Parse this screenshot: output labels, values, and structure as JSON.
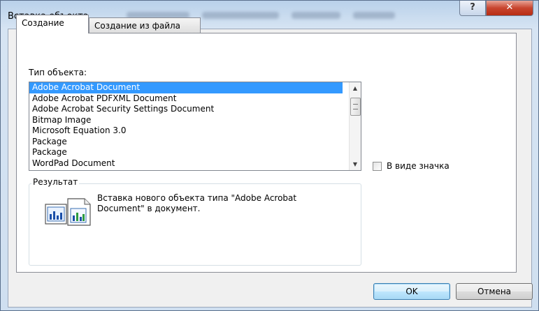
{
  "window": {
    "title": "Вставка объекта",
    "help_glyph": "?",
    "close_glyph": "✕"
  },
  "tabs": [
    {
      "label": "Создание",
      "active": true
    },
    {
      "label": "Создание из файла",
      "active": false
    }
  ],
  "object_type": {
    "label": "Тип объекта:",
    "items": [
      "Adobe Acrobat Document",
      "Adobe Acrobat PDFXML Document",
      "Adobe Acrobat Security Settings Document",
      "Bitmap Image",
      "Microsoft Equation 3.0",
      "Package",
      "Package",
      "WordPad Document"
    ],
    "selected_index": 0
  },
  "display_as_icon": {
    "label": "В виде значка",
    "checked": false
  },
  "result": {
    "title": "Результат",
    "text_line1": "Вставка нового объекта типа \"Adobe Acrobat",
    "text_line2": "Document\" в документ."
  },
  "buttons": {
    "ok": "OK",
    "cancel": "Отмена"
  },
  "icons": {
    "help": "help-icon",
    "close": "close-icon",
    "scroll_up": "scroll-up-arrow-icon",
    "scroll_down": "scroll-down-arrow-icon",
    "result": "insert-object-icon"
  },
  "colors": {
    "selection": "#3399ff",
    "close_button": "#c8452f",
    "title_bar": "#b9d1ea"
  }
}
